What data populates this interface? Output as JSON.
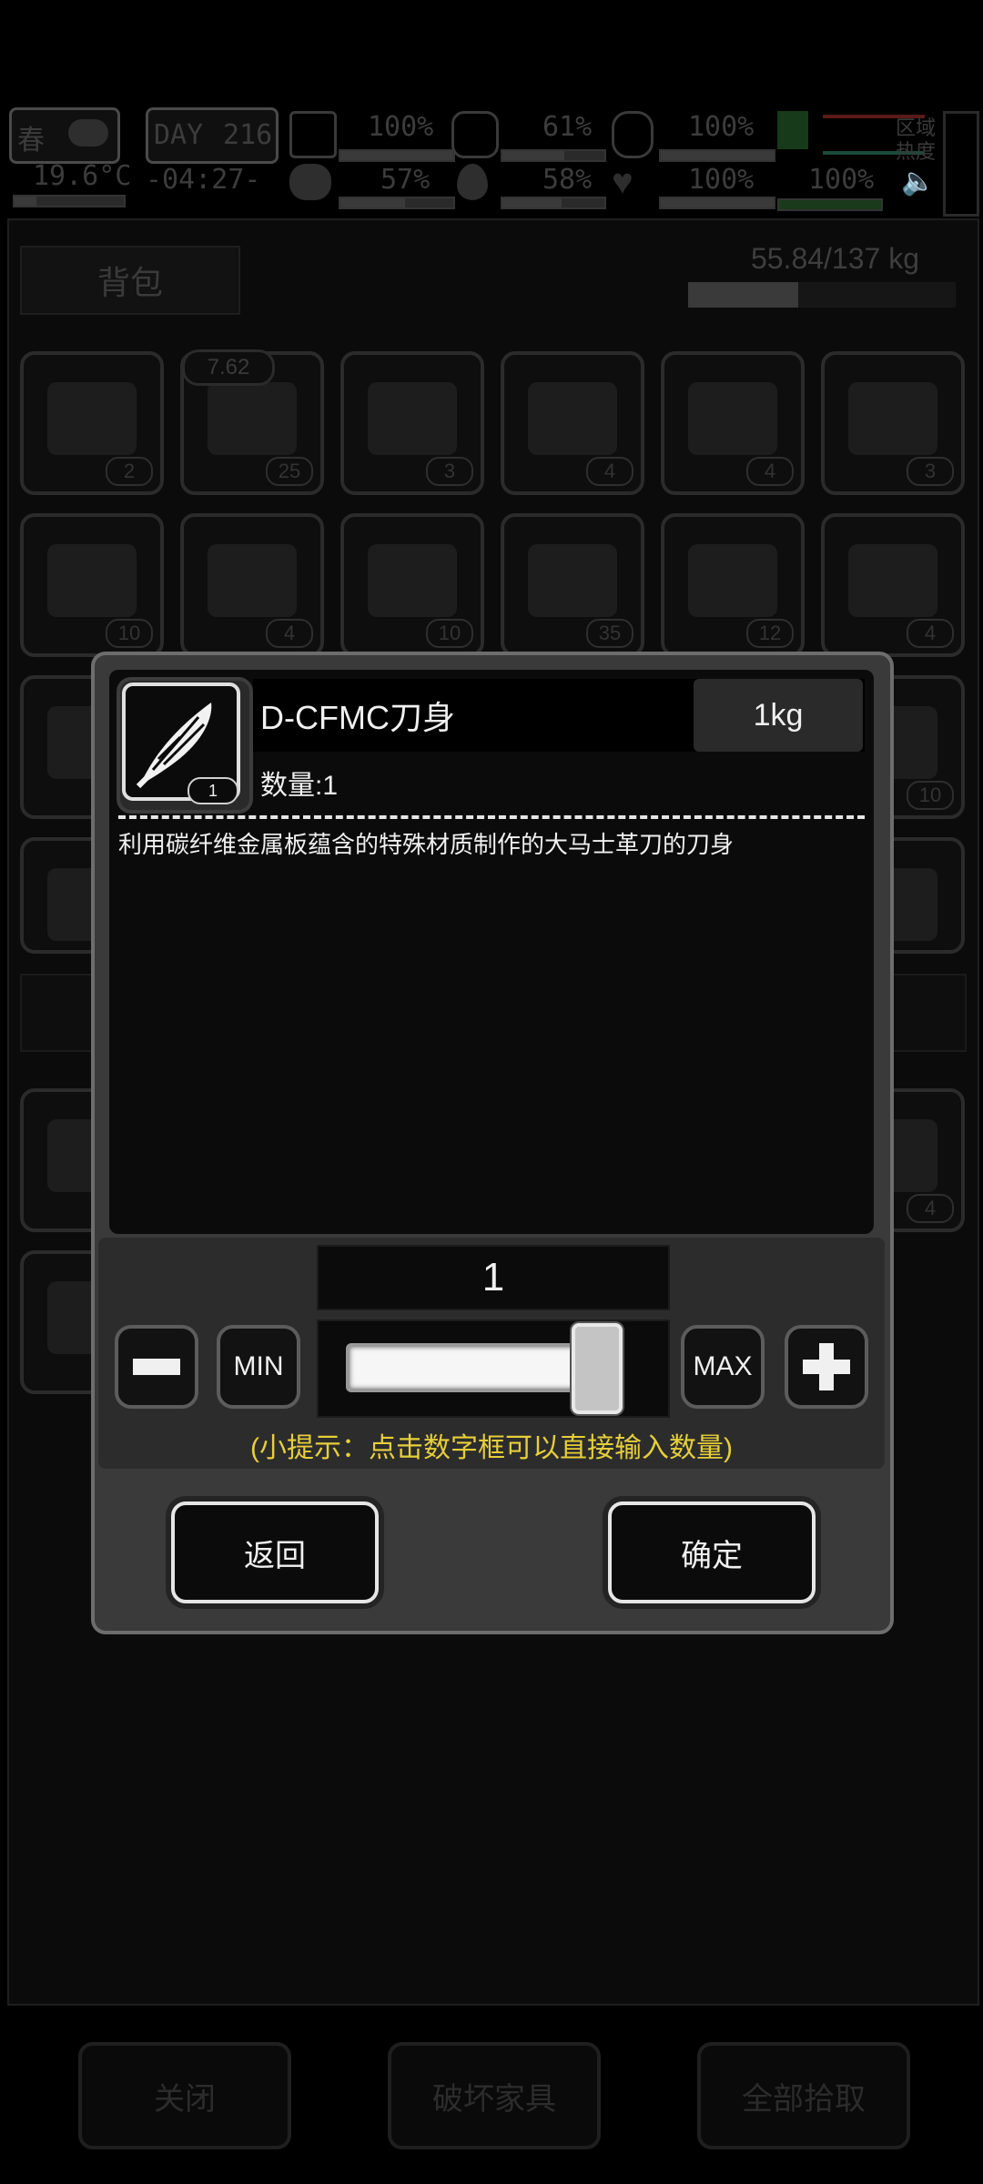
{
  "status": {
    "season": "春",
    "day_label": "DAY",
    "day": "216",
    "temperature": "19.6°C",
    "time": "-04:27-",
    "stats": [
      {
        "icon": "first-aid-icon",
        "value": "100%"
      },
      {
        "icon": "stomach-icon",
        "value": "61%"
      },
      {
        "icon": "lungs-icon",
        "value": "100%"
      },
      {
        "icon": "brain-icon",
        "value": "57%"
      },
      {
        "icon": "water-drop-icon",
        "value": "58%"
      },
      {
        "icon": "heart-icon",
        "value": "100%"
      },
      {
        "icon": "stamina-icon",
        "value": "100%"
      }
    ],
    "area_heat": "区域热度",
    "levels": {
      "hp": 1.0,
      "stomach": 0.61,
      "lungs": 1.0,
      "brain": 0.57,
      "water": 0.58,
      "heart": 1.0,
      "stamina": 1.0
    }
  },
  "bag": {
    "title": "背包",
    "weight": "55.84/137 kg",
    "weight_fraction": 0.41,
    "slot_tag": "7.62",
    "counts_row1": [
      "2",
      "25",
      "3",
      "4",
      "4",
      "3"
    ],
    "counts_row2": [
      "10",
      "4",
      "10",
      "35",
      "12",
      "4"
    ],
    "counts_partial": [
      "10",
      "4"
    ]
  },
  "modal": {
    "item_name": "D-CFMC刀身",
    "item_weight": "1kg",
    "icon_count": "1",
    "quantity_text": "数量:1",
    "description": "利用碳纤维金属板蕴含的特殊材质制作的大马士革刀的刀身",
    "selected_amount": "1",
    "slider_fraction": 1.0,
    "min_label": "MIN",
    "max_label": "MAX",
    "tip": "(小提示：点击数字框可以直接输入数量)",
    "back_label": "返回",
    "confirm_label": "确定"
  },
  "footer": {
    "close_label": "关闭",
    "destroy_label": "破坏家具",
    "pickup_all_label": "全部拾取"
  }
}
